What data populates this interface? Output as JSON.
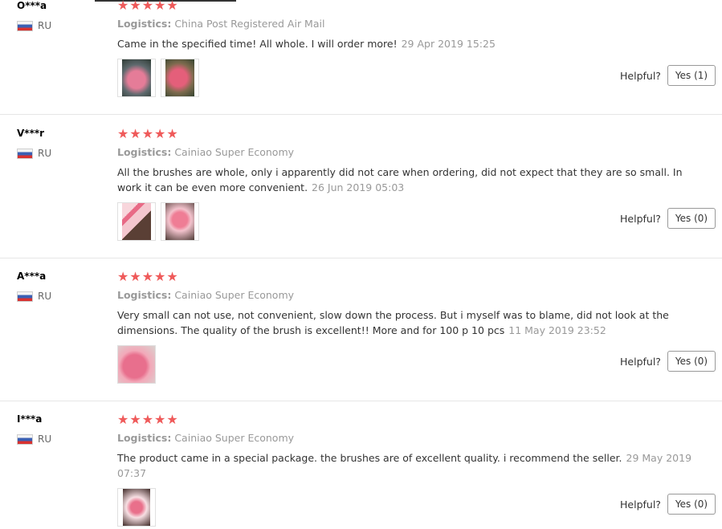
{
  "reviews": [
    {
      "user": "O***a",
      "country": "RU",
      "stars": "★★★★★",
      "logistics_label": "Logistics:",
      "logistics_value": "China Post Registered Air Mail",
      "text": "Came in the specified time! All whole. I will order more!",
      "date": "29 Apr 2019 15:25",
      "helpful_label": "Helpful?",
      "yes_label": "Yes (1)"
    },
    {
      "user": "V***r",
      "country": "RU",
      "stars": "★★★★★",
      "logistics_label": "Logistics:",
      "logistics_value": "Cainiao Super Economy",
      "text": "All the brushes are whole, only i apparently did not care when ordering, did not expect that they are so small. In work it can be even more convenient.",
      "date": "26 Jun 2019 05:03",
      "helpful_label": "Helpful?",
      "yes_label": "Yes (0)"
    },
    {
      "user": "A***a",
      "country": "RU",
      "stars": "★★★★★",
      "logistics_label": "Logistics:",
      "logistics_value": "Cainiao Super Economy",
      "text": "Very small can not use, not convenient, slow down the process. But i myself was to blame, did not look at the dimensions. The quality of the brush is excellent!! More and for 100 p 10 pcs",
      "date": "11 May 2019 23:52",
      "helpful_label": "Helpful?",
      "yes_label": "Yes (0)"
    },
    {
      "user": "I***a",
      "country": "RU",
      "stars": "★★★★★",
      "logistics_label": "Logistics:",
      "logistics_value": "Cainiao Super Economy",
      "text": "The product came in a special package. the brushes are of excellent quality. i recommend the seller.",
      "date": "29 May 2019 07:37",
      "helpful_label": "Helpful?",
      "yes_label": "Yes (0)"
    }
  ],
  "colors": {
    "star": "#ef5a5a",
    "muted_text": "#999999",
    "divider": "#e6e6e6"
  },
  "icons": {
    "flag": "russia-flag-icon",
    "star": "star-icon"
  }
}
